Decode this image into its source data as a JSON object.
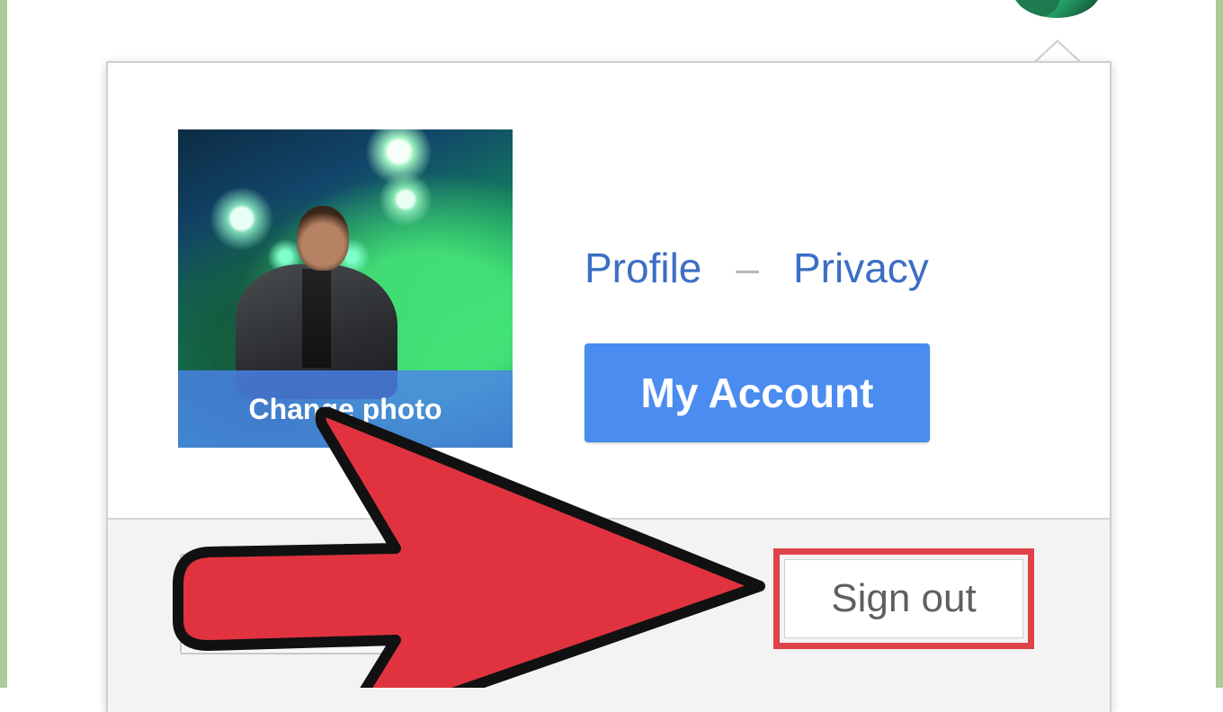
{
  "account_popup": {
    "change_photo_label": "Change photo",
    "links": {
      "profile": "Profile",
      "separator": "–",
      "privacy": "Privacy"
    },
    "my_account_label": "My Account",
    "sign_out_label": "Sign out"
  },
  "colors": {
    "link_blue": "#3b6fc4",
    "primary_button": "#4a8cf0",
    "highlight_red": "#e0424a",
    "arrow_red": "#e0333f"
  },
  "annotation": {
    "arrow_icon": "red-pointer-arrow-icon",
    "highlight": "sign-out-red-box"
  }
}
